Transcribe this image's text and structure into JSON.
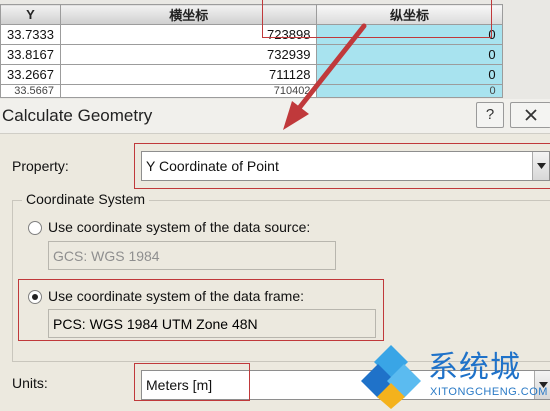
{
  "table": {
    "headers": [
      "Y",
      "横坐标",
      "纵坐标"
    ],
    "rows": [
      [
        "33.7333",
        "723898",
        "0"
      ],
      [
        "33.8167",
        "732939",
        "0"
      ],
      [
        "33.2667",
        "711128",
        "0"
      ],
      [
        "33.5667",
        "710402",
        "0"
      ]
    ]
  },
  "dialog": {
    "title": "Calculate Geometry",
    "help_label": "?",
    "property_label": "Property:",
    "property_value": "Y Coordinate of Point",
    "coord_system_label": "Coordinate System",
    "option_source_label": "Use coordinate system of the data source:",
    "option_source_value": "GCS: WGS 1984",
    "option_frame_label": "Use coordinate system of the data frame:",
    "option_frame_value": "PCS: WGS 1984 UTM Zone 48N",
    "units_label": "Units:",
    "units_value": "Meters [m]"
  },
  "watermark": {
    "text": "系统城",
    "sub": "XITONGCHENG.COM"
  },
  "colors": {
    "annotation_red": "#c0393b",
    "selected_column": "#a8e3ef",
    "watermark_blue": "#1f72c9"
  }
}
